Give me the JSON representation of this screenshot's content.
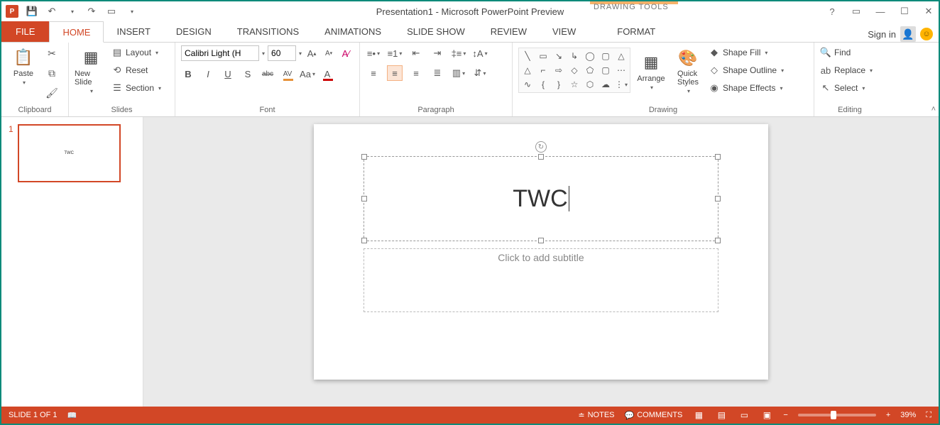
{
  "app": {
    "title": "Presentation1 - Microsoft PowerPoint Preview",
    "context_tab_header": "DRAWING TOOLS"
  },
  "tabs": {
    "file": "FILE",
    "home": "HOME",
    "insert": "INSERT",
    "design": "DESIGN",
    "transitions": "TRANSITIONS",
    "animations": "ANIMATIONS",
    "slideshow": "SLIDE SHOW",
    "review": "REVIEW",
    "view": "VIEW",
    "format": "FORMAT",
    "signin": "Sign in"
  },
  "clipboard": {
    "group": "Clipboard",
    "paste": "Paste"
  },
  "slides": {
    "group": "Slides",
    "new_slide": "New Slide",
    "layout": "Layout",
    "reset": "Reset",
    "section": "Section"
  },
  "font": {
    "group": "Font",
    "name": "Calibri Light (H",
    "size": "60",
    "bold": "B",
    "italic": "I",
    "underline": "U",
    "shadow": "S",
    "strike": "abc",
    "spacing": "AV",
    "case": "Aa",
    "color": "A"
  },
  "paragraph": {
    "group": "Paragraph"
  },
  "drawing": {
    "group": "Drawing",
    "arrange": "Arrange",
    "quick_styles_l1": "Quick",
    "quick_styles_l2": "Styles",
    "shape_fill": "Shape Fill",
    "shape_outline": "Shape Outline",
    "shape_effects": "Shape Effects"
  },
  "editing": {
    "group": "Editing",
    "find": "Find",
    "replace": "Replace",
    "select": "Select"
  },
  "thumbs": {
    "items": [
      {
        "num": "1",
        "title": "TWC"
      }
    ]
  },
  "slide": {
    "title": "TWC",
    "subtitle_placeholder": "Click to add subtitle"
  },
  "status": {
    "slide_counter": "SLIDE 1 OF 1",
    "notes": "NOTES",
    "comments": "COMMENTS",
    "zoom": "39%"
  }
}
